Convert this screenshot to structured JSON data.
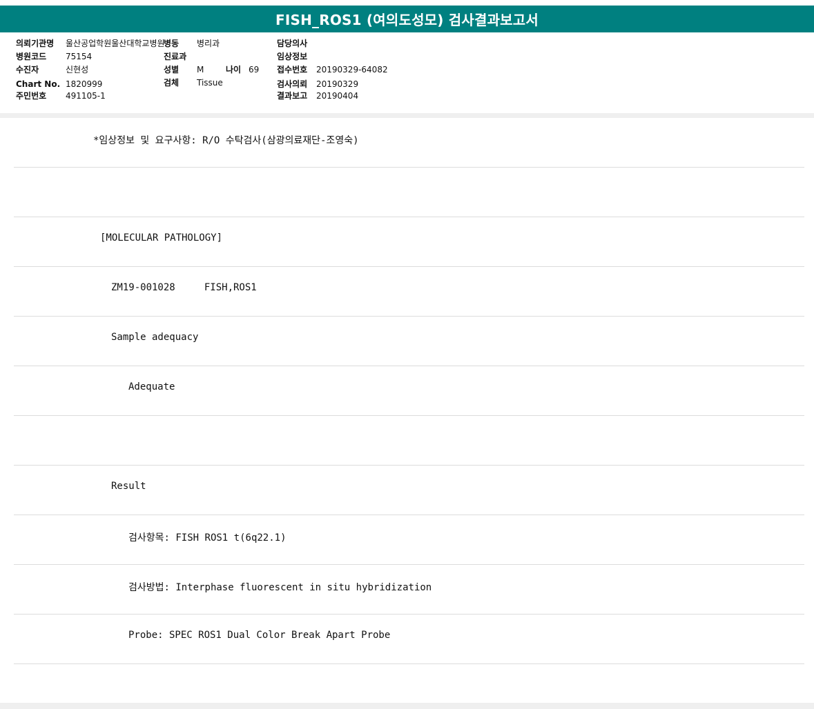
{
  "title": "FISH_ROS1 (여의도성모) 검사결과보고서",
  "info": {
    "req_inst_label": "의뢰기관명",
    "req_inst_value": "울산공업학원울산대학교병원",
    "ward_label": "병동",
    "ward_value": "병리과",
    "doctor_label": "담당의사",
    "hosp_code_label": "병원코드",
    "hosp_code_value": "75154",
    "dept_label": "진료과",
    "clinical_label": "임상정보",
    "examinee_label": "수진자",
    "examinee_value": "신현성",
    "sex_label": "성별",
    "sex_value": "M",
    "age_label": "나이",
    "age_value": "69",
    "receipt_label": "접수번호",
    "receipt_value": "20190329-64082",
    "chart_label": "Chart No.",
    "chart_value": "1820999",
    "specimen_label": "검체",
    "specimen_value": "Tissue",
    "exam_req_label": "검사의뢰",
    "exam_req_value": "20190329",
    "resident_label": "주민번호",
    "resident_value": "491105-1",
    "result_report_label": "결과보고",
    "result_report_value": "20190404"
  },
  "report_lines": [
    "*임상정보 및 요구사항: R/O 수탁검사(삼광의료재단-조영숙)",
    "",
    "[MOLECULAR PATHOLOGY]",
    "ZM19-001028     FISH,ROS1",
    "Sample adequacy",
    "Adequate",
    "",
    "Result",
    "검사항목: FISH ROS1 t(6q22.1)",
    "검사방법: Interphase fluorescent in situ hybridization",
    "Probe: SPEC ROS1 Dual Color Break Apart Probe"
  ]
}
